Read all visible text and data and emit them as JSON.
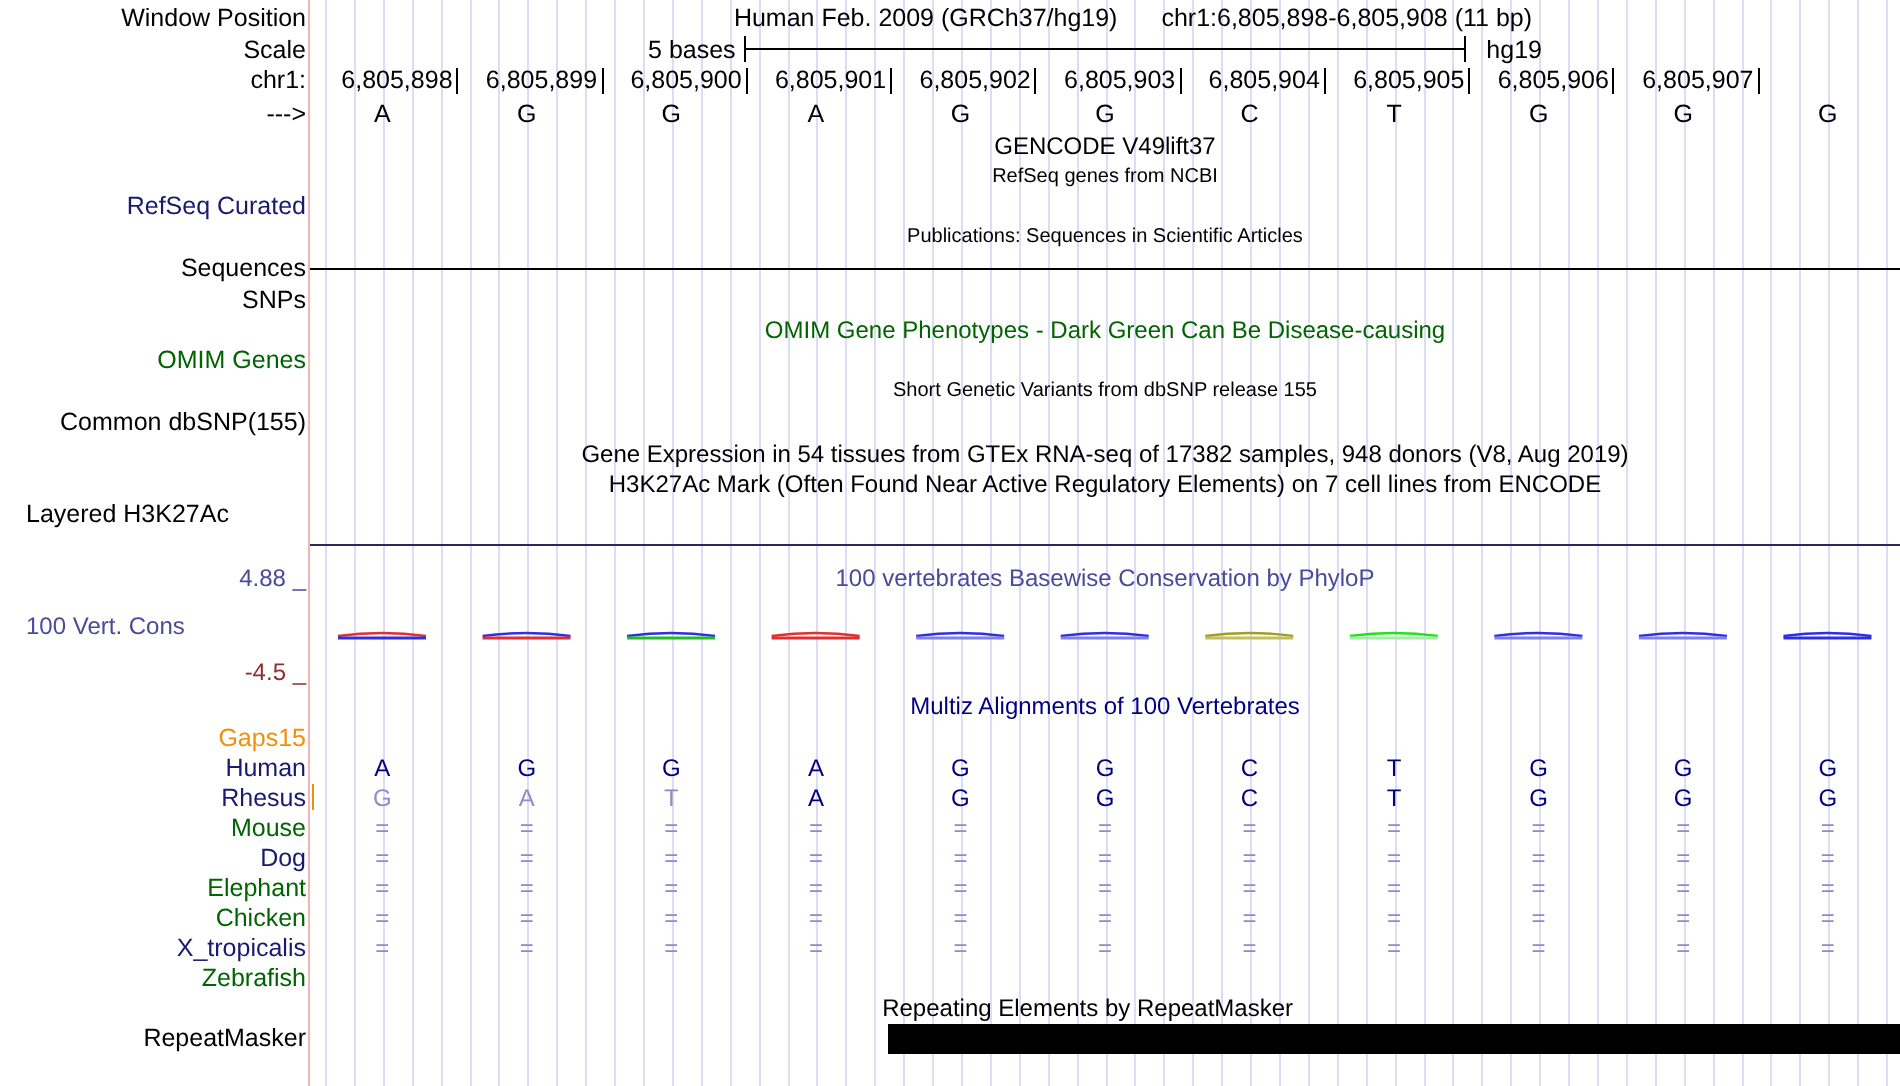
{
  "header": {
    "label": "Window Position",
    "title": "Human Feb. 2009 (GRCh37/hg19)",
    "position": "chr1:6,805,898-6,805,908 (11 bp)"
  },
  "scale": {
    "label": "Scale",
    "length": "5 bases",
    "assembly": "hg19"
  },
  "ruler": {
    "label": "chr1:",
    "positions": [
      "6,805,898",
      "6,805,899",
      "6,805,900",
      "6,805,901",
      "6,805,902",
      "6,805,903",
      "6,805,904",
      "6,805,905",
      "6,805,906",
      "6,805,907"
    ]
  },
  "sequence": {
    "label": "--->",
    "bases": [
      "A",
      "G",
      "G",
      "A",
      "G",
      "G",
      "C",
      "T",
      "G",
      "G",
      "G"
    ]
  },
  "rows": [
    {
      "kind": "title",
      "text": "GENCODE V49lift37",
      "color": "#000000"
    },
    {
      "kind": "note",
      "text": "RefSeq genes from NCBI",
      "color": "#000000"
    },
    {
      "kind": "label",
      "label": "RefSeq Curated",
      "color": "#191970"
    },
    {
      "kind": "note",
      "text": "Publications: Sequences in Scientific Articles",
      "color": "#000000"
    },
    {
      "kind": "label_rule",
      "label": "Sequences",
      "color": "#000000"
    },
    {
      "kind": "label",
      "label": "SNPs",
      "color": "#000000"
    },
    {
      "kind": "title",
      "text": "OMIM Gene Phenotypes - Dark Green Can Be Disease-causing",
      "color": "#006400"
    },
    {
      "kind": "label",
      "label": "OMIM Genes",
      "color": "#006400"
    },
    {
      "kind": "note",
      "text": "Short Genetic Variants from dbSNP release 155",
      "color": "#000000"
    },
    {
      "kind": "label",
      "label": "Common dbSNP(155)",
      "color": "#000000"
    },
    {
      "kind": "title",
      "text": "Gene Expression in 54 tissues from GTEx RNA-seq of 17382 samples, 948 donors (V8, Aug 2019)",
      "color": "#000000"
    },
    {
      "kind": "title",
      "text": "H3K27Ac Mark (Often Found Near Active Regulatory Elements) on 7 cell lines from ENCODE",
      "color": "#000000"
    },
    {
      "kind": "wide_label",
      "label": "Layered H3K27Ac",
      "color": "#000000"
    },
    {
      "kind": "spacer"
    }
  ],
  "conservation": {
    "title": "100 vertebrates Basewise Conservation by PhyloP",
    "label": "100 Vert. Cons",
    "max": "4.88 _",
    "min": "-4.5 _"
  },
  "multiz": {
    "title": "Multiz Alignments of 100 Vertebrates",
    "gaps_label": "Gaps",
    "gaps_value": "15",
    "species": [
      {
        "name": "Human",
        "color": "#191970",
        "gap_mark": false,
        "bases": [
          {
            "base": "A",
            "faded": false
          },
          {
            "base": "G",
            "faded": false
          },
          {
            "base": "G",
            "faded": false
          },
          {
            "base": "A",
            "faded": false
          },
          {
            "base": "G",
            "faded": false
          },
          {
            "base": "G",
            "faded": false
          },
          {
            "base": "C",
            "faded": false
          },
          {
            "base": "T",
            "faded": false
          },
          {
            "base": "G",
            "faded": false
          },
          {
            "base": "G",
            "faded": false
          },
          {
            "base": "G",
            "faded": false
          }
        ]
      },
      {
        "name": "Rhesus",
        "color": "#191970",
        "gap_mark": true,
        "bases": [
          {
            "base": "G",
            "faded": true
          },
          {
            "base": "A",
            "faded": true
          },
          {
            "base": "T",
            "faded": true
          },
          {
            "base": "A",
            "faded": false
          },
          {
            "base": "G",
            "faded": false
          },
          {
            "base": "G",
            "faded": false
          },
          {
            "base": "C",
            "faded": false
          },
          {
            "base": "T",
            "faded": false
          },
          {
            "base": "G",
            "faded": false
          },
          {
            "base": "G",
            "faded": false
          },
          {
            "base": "G",
            "faded": false
          }
        ]
      },
      {
        "name": "Mouse",
        "color": "#006400",
        "gap_mark": false,
        "bases": [
          {
            "base": "=",
            "faded": true
          },
          {
            "base": "=",
            "faded": true
          },
          {
            "base": "=",
            "faded": true
          },
          {
            "base": "=",
            "faded": true
          },
          {
            "base": "=",
            "faded": true
          },
          {
            "base": "=",
            "faded": true
          },
          {
            "base": "=",
            "faded": true
          },
          {
            "base": "=",
            "faded": true
          },
          {
            "base": "=",
            "faded": true
          },
          {
            "base": "=",
            "faded": true
          },
          {
            "base": "=",
            "faded": true
          }
        ]
      },
      {
        "name": "Dog",
        "color": "#191970",
        "gap_mark": false,
        "bases": [
          {
            "base": "=",
            "faded": true
          },
          {
            "base": "=",
            "faded": true
          },
          {
            "base": "=",
            "faded": true
          },
          {
            "base": "=",
            "faded": true
          },
          {
            "base": "=",
            "faded": true
          },
          {
            "base": "=",
            "faded": true
          },
          {
            "base": "=",
            "faded": true
          },
          {
            "base": "=",
            "faded": true
          },
          {
            "base": "=",
            "faded": true
          },
          {
            "base": "=",
            "faded": true
          },
          {
            "base": "=",
            "faded": true
          }
        ]
      },
      {
        "name": "Elephant",
        "color": "#006400",
        "gap_mark": false,
        "bases": [
          {
            "base": "=",
            "faded": true
          },
          {
            "base": "=",
            "faded": true
          },
          {
            "base": "=",
            "faded": true
          },
          {
            "base": "=",
            "faded": true
          },
          {
            "base": "=",
            "faded": true
          },
          {
            "base": "=",
            "faded": true
          },
          {
            "base": "=",
            "faded": true
          },
          {
            "base": "=",
            "faded": true
          },
          {
            "base": "=",
            "faded": true
          },
          {
            "base": "=",
            "faded": true
          },
          {
            "base": "=",
            "faded": true
          }
        ]
      },
      {
        "name": "Chicken",
        "color": "#006400",
        "gap_mark": false,
        "bases": [
          {
            "base": "=",
            "faded": true
          },
          {
            "base": "=",
            "faded": true
          },
          {
            "base": "=",
            "faded": true
          },
          {
            "base": "=",
            "faded": true
          },
          {
            "base": "=",
            "faded": true
          },
          {
            "base": "=",
            "faded": true
          },
          {
            "base": "=",
            "faded": true
          },
          {
            "base": "=",
            "faded": true
          },
          {
            "base": "=",
            "faded": true
          },
          {
            "base": "=",
            "faded": true
          },
          {
            "base": "=",
            "faded": true
          }
        ]
      },
      {
        "name": "X_tropicalis",
        "color": "#191970",
        "gap_mark": false,
        "bases": [
          {
            "base": "=",
            "faded": true
          },
          {
            "base": "=",
            "faded": true
          },
          {
            "base": "=",
            "faded": true
          },
          {
            "base": "=",
            "faded": true
          },
          {
            "base": "=",
            "faded": true
          },
          {
            "base": "=",
            "faded": true
          },
          {
            "base": "=",
            "faded": true
          },
          {
            "base": "=",
            "faded": true
          },
          {
            "base": "=",
            "faded": true
          },
          {
            "base": "=",
            "faded": true
          },
          {
            "base": "=",
            "faded": true
          }
        ]
      },
      {
        "name": "Zebrafish",
        "color": "#006400",
        "gap_mark": false
      }
    ]
  },
  "repeats": {
    "title": "Repeating Elements by RepeatMasker",
    "label": "RepeatMasker"
  }
}
